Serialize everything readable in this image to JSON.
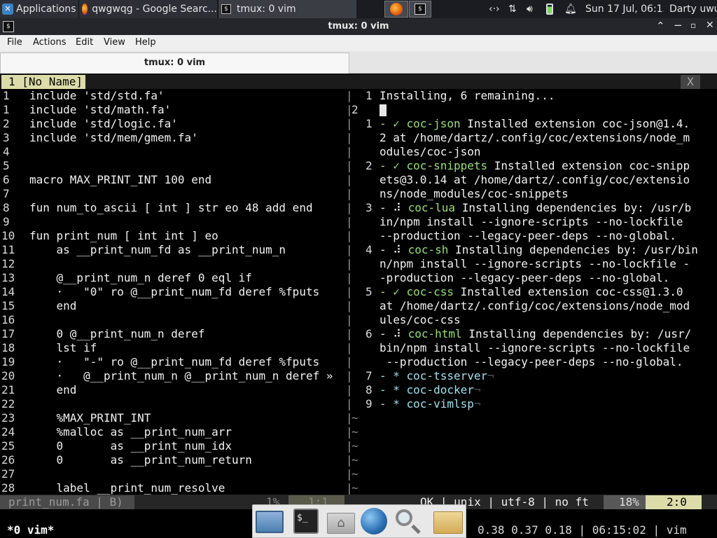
{
  "topbar": {
    "apps_label": "Applications",
    "tab_firefox": "qwgwqg - Google Searc...",
    "tab_term": "tmux: 0 vim",
    "datetime": "Sun 17 Jul, 06:15",
    "user": "Darty uwu"
  },
  "window": {
    "title": "tmux: 0 vim"
  },
  "menu": {
    "file": "File",
    "actions": "Actions",
    "edit": "Edit",
    "view": "View",
    "help": "Help"
  },
  "tab": {
    "label": "tmux: 0 vim"
  },
  "vim": {
    "tabline_label": "1 [No Name]",
    "tabline_close": "X",
    "left_lines": [
      {
        "n": "1",
        "t": "include 'std/std.fa'"
      },
      {
        "n": "1",
        "t": "include 'std/math.fa'"
      },
      {
        "n": "2",
        "t": "include 'std/logic.fa'"
      },
      {
        "n": "3",
        "t": "include 'std/mem/gmem.fa'"
      },
      {
        "n": "4",
        "t": ""
      },
      {
        "n": "5",
        "t": ""
      },
      {
        "n": "6",
        "t": "macro MAX_PRINT_INT 100 end"
      },
      {
        "n": "7",
        "t": ""
      },
      {
        "n": "8",
        "t": "fun num_to_ascii [ int ] str eo 48 add end"
      },
      {
        "n": "9",
        "t": ""
      },
      {
        "n": "10",
        "t": "fun print_num [ int int ] eo"
      },
      {
        "n": "11",
        "t": "    as __print_num_fd as __print_num_n"
      },
      {
        "n": "12",
        "t": ""
      },
      {
        "n": "13",
        "t": "    @__print_num_n deref 0 eql if"
      },
      {
        "n": "14",
        "t": "    ·   \"0\" ro @__print_num_fd deref %fputs"
      },
      {
        "n": "15",
        "t": "    end"
      },
      {
        "n": "16",
        "t": ""
      },
      {
        "n": "17",
        "t": "    0 @__print_num_n deref"
      },
      {
        "n": "18",
        "t": "    lst if"
      },
      {
        "n": "19",
        "t": "    ·   \"-\" ro @__print_num_fd deref %fputs"
      },
      {
        "n": "20",
        "t": "    ·   @__print_num_n @__print_num_n deref »"
      },
      {
        "n": "21",
        "t": "    end"
      },
      {
        "n": "22",
        "t": ""
      },
      {
        "n": "23",
        "t": "    %MAX_PRINT_INT"
      },
      {
        "n": "24",
        "t": "    %malloc as __print_num_arr"
      },
      {
        "n": "25",
        "t": "    0       as __print_num_idx"
      },
      {
        "n": "26",
        "t": "    0       as __print_num_return"
      },
      {
        "n": "27",
        "t": ""
      },
      {
        "n": "28",
        "t": "    label __print_num_resolve"
      }
    ],
    "right_header": "Installing, 6 remaining...",
    "right_lines": [
      {
        "n": "1",
        "m": "- ✓ ",
        "name": "coc-json",
        "rest": " Installed extension coc-json@1.4."
      },
      {
        "n": "",
        "m": "",
        "name": "",
        "rest": "2 at /home/dartz/.config/coc/extensions/node_m"
      },
      {
        "n": "",
        "m": "",
        "name": "",
        "rest": "odules/coc-json"
      },
      {
        "n": "2",
        "m": "- ✓ ",
        "name": "coc-snippets",
        "rest": " Installed extension coc-snipp"
      },
      {
        "n": "",
        "m": "",
        "name": "",
        "rest": "ets@3.0.14 at /home/dartz/.config/coc/extensio"
      },
      {
        "n": "",
        "m": "",
        "name": "",
        "rest": "ns/node_modules/coc-snippets"
      },
      {
        "n": "3",
        "m": "- ⠼ ",
        "name": "coc-lua",
        "rest": " Installing dependencies by: /usr/b"
      },
      {
        "n": "",
        "m": "",
        "name": "",
        "rest": "in/npm install --ignore-scripts --no-lockfile"
      },
      {
        "n": "",
        "m": "",
        "name": "",
        "rest": "--production --legacy-peer-deps --no-global."
      },
      {
        "n": "4",
        "m": "- ⠼ ",
        "name": "coc-sh",
        "rest": " Installing dependencies by: /usr/bin"
      },
      {
        "n": "",
        "m": "",
        "name": "",
        "rest": "n/npm install --ignore-scripts --no-lockfile -"
      },
      {
        "n": "",
        "m": "",
        "name": "",
        "rest": "-production --legacy-peer-deps --no-global."
      },
      {
        "n": "5",
        "m": "- ✓ ",
        "name": "coc-css",
        "rest": " Installed extension coc-css@1.3.0"
      },
      {
        "n": "",
        "m": "",
        "name": "",
        "rest": "at /home/dartz/.config/coc/extensions/node_mod"
      },
      {
        "n": "",
        "m": "",
        "name": "",
        "rest": "ules/coc-css"
      },
      {
        "n": "6",
        "m": "- ⠼ ",
        "name": "coc-html",
        "rest": " Installing dependencies by: /usr/"
      },
      {
        "n": "",
        "m": "",
        "name": "",
        "rest": "bin/npm install --ignore-scripts --no-lockfile"
      },
      {
        "n": "",
        "m": "",
        "name": "",
        "rest": " --production --legacy-peer-deps --no-global."
      },
      {
        "n": "7",
        "m": "- * ",
        "name": "coc-tsserver",
        "rest": ""
      },
      {
        "n": "8",
        "m": "- * ",
        "name": "coc-docker",
        "rest": ""
      },
      {
        "n": "9",
        "m": "- * ",
        "name": "coc-vimlsp",
        "rest": ""
      }
    ],
    "status_left": "print_num.fa | B)",
    "status_pct_left": "1%",
    "status_pos_left": "1:1",
    "status_right_ft": "OK | unix | utf-8 | no ft",
    "status_right_pct": "18%",
    "status_right_pos": "2:0",
    "tmux_left": "*0 vim*",
    "tmux_right": "0.38 0.37 0.18 | 06:15:02 | vim"
  },
  "colors": {
    "accent_green": "#9adf7c",
    "accent_cyan": "#9ee0ef",
    "status_bg": "#3a3a3a",
    "pos_bg": "#dcdcaa"
  }
}
